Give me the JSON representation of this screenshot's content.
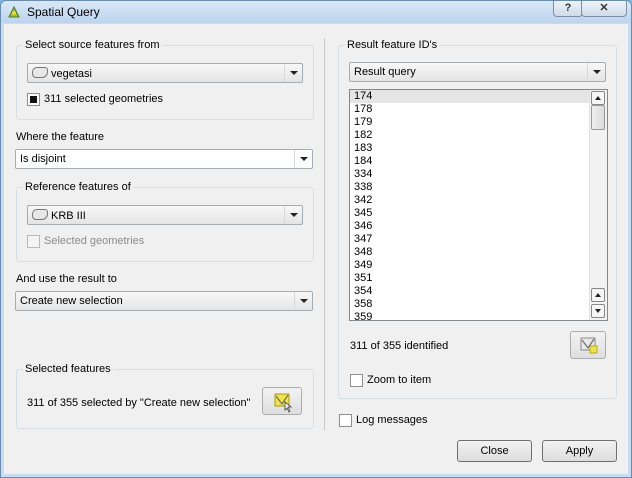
{
  "window": {
    "title": "Spatial Query",
    "help_label": "?",
    "close_label": "✕"
  },
  "source": {
    "group_title": "Select source features from",
    "layer": "vegetasi",
    "selected_checkbox_label": "311 selected geometries",
    "selected_checked": true
  },
  "where": {
    "label": "Where the feature",
    "value": "Is disjoint"
  },
  "reference": {
    "group_title": "Reference features of",
    "layer": "KRB III",
    "selected_checkbox_label": "Selected geometries",
    "selected_checked": false
  },
  "result_use": {
    "label": "And use the result to",
    "value": "Create new selection"
  },
  "selected_features": {
    "group_title": "Selected features",
    "summary": "311 of 355 selected by \"Create new selection\""
  },
  "results": {
    "group_title": "Result feature ID's",
    "query_value": "Result query",
    "ids": [
      "174",
      "178",
      "179",
      "182",
      "183",
      "184",
      "334",
      "338",
      "342",
      "345",
      "346",
      "347",
      "348",
      "349",
      "351",
      "354",
      "358",
      "359"
    ],
    "identified_text": "311 of 355 identified",
    "zoom_label": "Zoom to item",
    "zoom_checked": false
  },
  "log": {
    "label": "Log messages",
    "checked": false
  },
  "buttons": {
    "close_label": "Close",
    "apply_label": "Apply"
  },
  "icons": {
    "app": "qgis-icon",
    "layer": "polygon-layer-icon",
    "selection_tool": "select-features-icon"
  }
}
